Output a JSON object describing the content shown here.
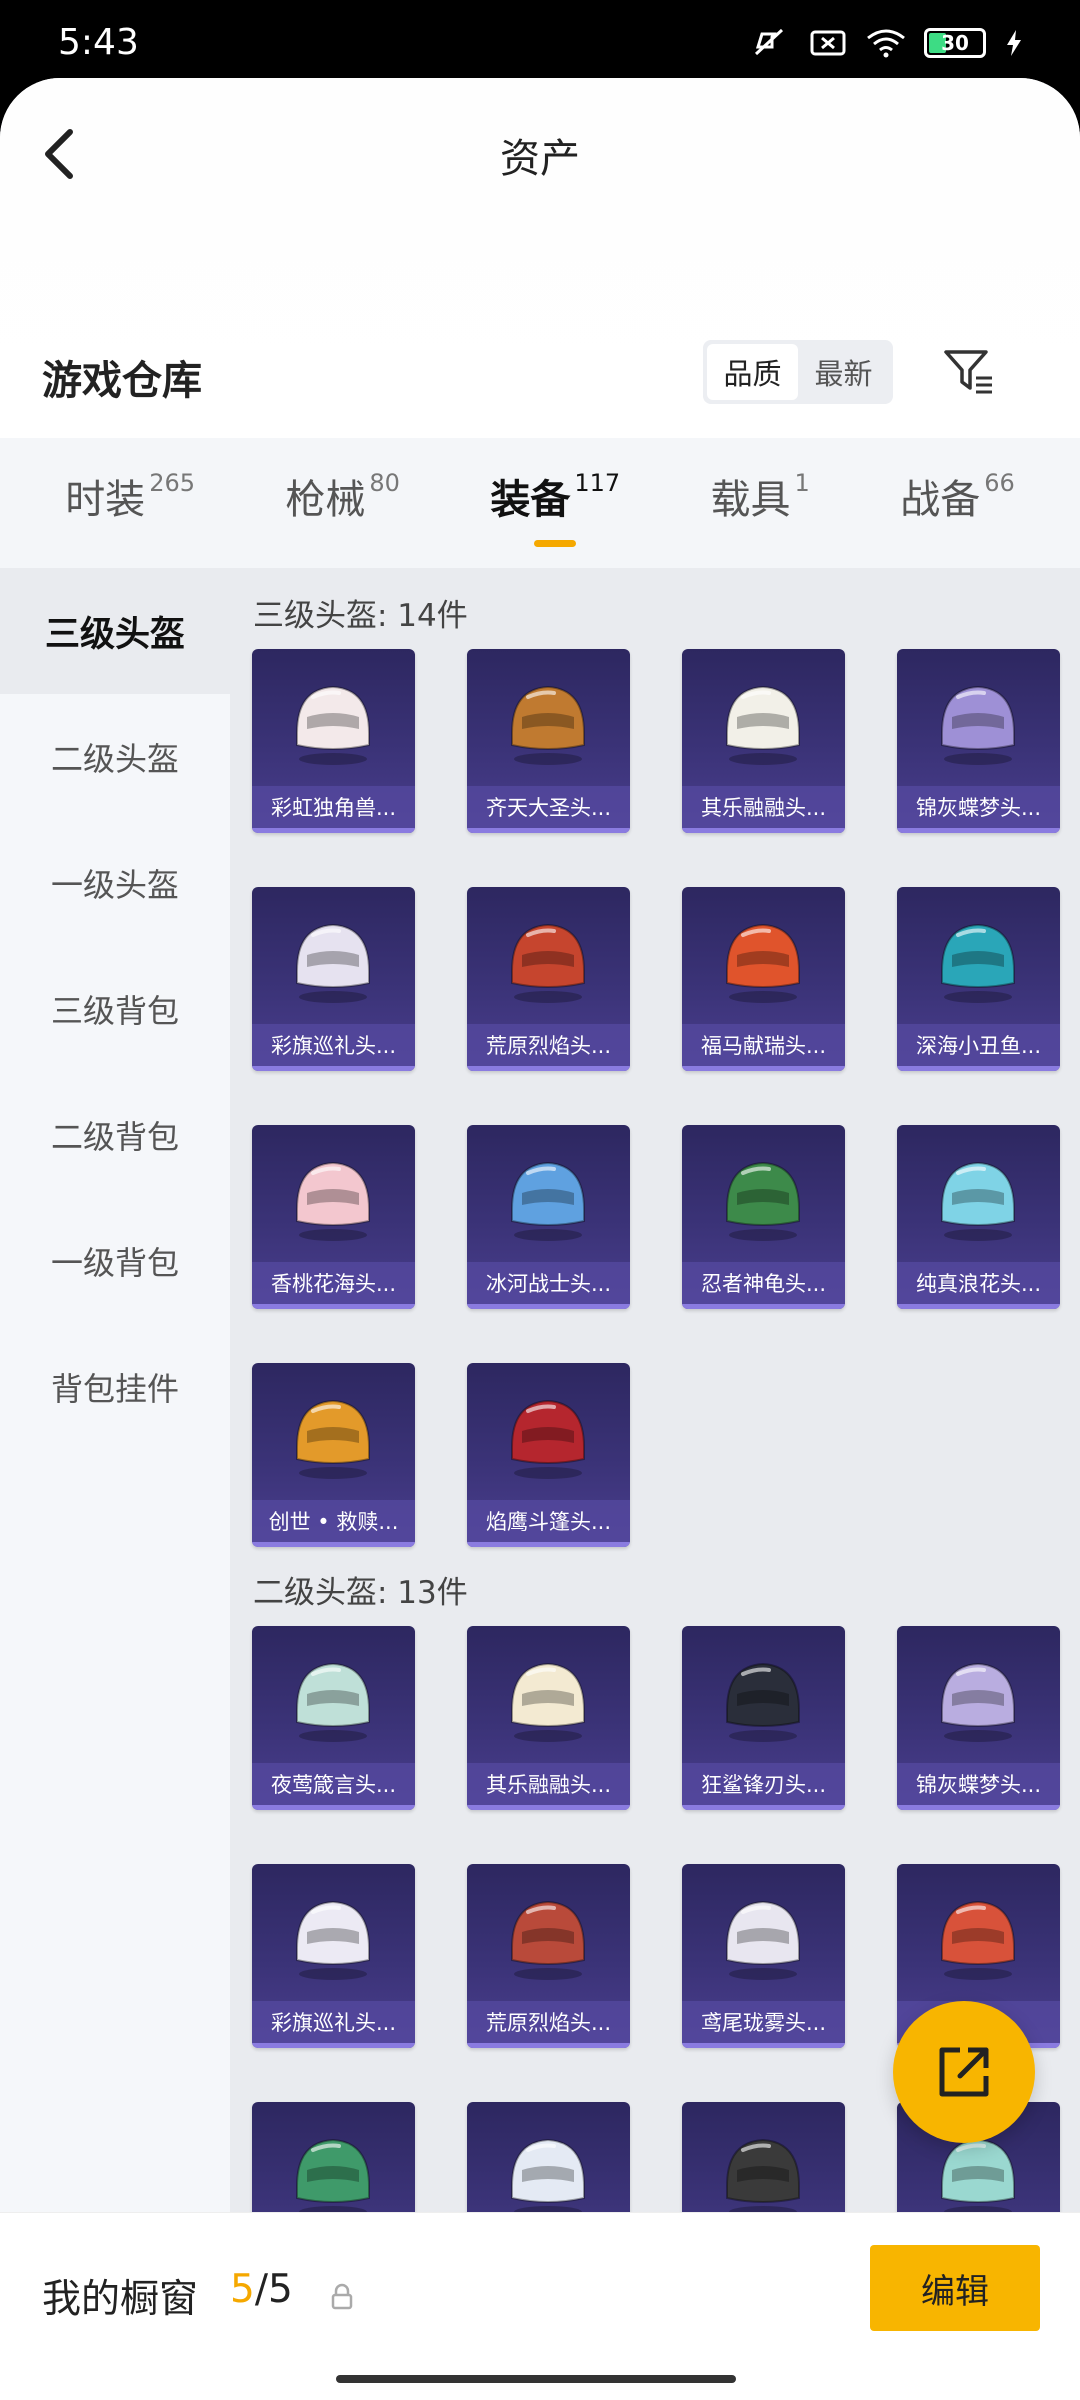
{
  "status_bar": {
    "time": "5:43",
    "battery": "30"
  },
  "header": {
    "title": "资产",
    "back_icon": "chevron-left-icon"
  },
  "warehouse": {
    "title": "游戏仓库",
    "sort_options": [
      {
        "label": "品质",
        "active": true
      },
      {
        "label": "最新",
        "active": false
      }
    ],
    "filter_icon": "filter-icon"
  },
  "tabs": [
    {
      "label": "时装",
      "count": "265",
      "active": false
    },
    {
      "label": "枪械",
      "count": "80",
      "active": false
    },
    {
      "label": "装备",
      "count": "117",
      "active": true
    },
    {
      "label": "载具",
      "count": "1",
      "active": false
    },
    {
      "label": "战备",
      "count": "66",
      "active": false
    }
  ],
  "sidebar": [
    {
      "label": "三级头盔",
      "active": true
    },
    {
      "label": "二级头盔",
      "active": false
    },
    {
      "label": "一级头盔",
      "active": false
    },
    {
      "label": "三级背包",
      "active": false
    },
    {
      "label": "二级背包",
      "active": false
    },
    {
      "label": "一级背包",
      "active": false
    },
    {
      "label": "背包挂件",
      "active": false
    }
  ],
  "groups": [
    {
      "title": "三级头盔: 14件",
      "items": [
        {
          "name": "彩虹独角兽...",
          "color": "#f3e9ea"
        },
        {
          "name": "齐天大圣头...",
          "color": "#c07a30"
        },
        {
          "name": "其乐融融头...",
          "color": "#f2f0e8"
        },
        {
          "name": "锦灰蝶梦头...",
          "color": "#9e90d6"
        },
        {
          "name": "彩旗巡礼头...",
          "color": "#e6e2f0"
        },
        {
          "name": "荒原烈焰头...",
          "color": "#c6452e"
        },
        {
          "name": "福马献瑞头...",
          "color": "#e0542c"
        },
        {
          "name": "深海小丑鱼...",
          "color": "#2aa6b8"
        },
        {
          "name": "香桃花海头...",
          "color": "#f3c7cf"
        },
        {
          "name": "冰河战士头...",
          "color": "#5fa1e0"
        },
        {
          "name": "忍者神龟头...",
          "color": "#3d8a4a"
        },
        {
          "name": "纯真浪花头...",
          "color": "#7fd3e6"
        },
        {
          "name": "创世 • 救赎...",
          "color": "#e39a2a"
        },
        {
          "name": "焰鹰斗篷头...",
          "color": "#b5262e"
        }
      ]
    },
    {
      "title": "二级头盔: 13件",
      "items": [
        {
          "name": "夜莺箴言头...",
          "color": "#bfe0d8"
        },
        {
          "name": "其乐融融头...",
          "color": "#f3ead2"
        },
        {
          "name": "狂鲨锋刃头...",
          "color": "#2a2e3a"
        },
        {
          "name": "锦灰蝶梦头...",
          "color": "#b9ade0"
        },
        {
          "name": "彩旗巡礼头...",
          "color": "#eceaf4"
        },
        {
          "name": "荒原烈焰头...",
          "color": "#b94a3a"
        },
        {
          "name": "鸢尾珑雾头...",
          "color": "#e8e6f0"
        },
        {
          "name": "",
          "color": "#d8523a"
        },
        {
          "name": "",
          "color": "#3f9a6a"
        },
        {
          "name": "",
          "color": "#e4eaf4"
        },
        {
          "name": "",
          "color": "#3a3a3a"
        },
        {
          "name": "",
          "color": "#9ad8d0"
        }
      ]
    }
  ],
  "bottom_bar": {
    "label": "我的橱窗",
    "count_current": "5",
    "count_sep": "/",
    "count_total": "5",
    "edit_label": "编辑"
  },
  "fab": {
    "icon": "external-link-icon"
  }
}
